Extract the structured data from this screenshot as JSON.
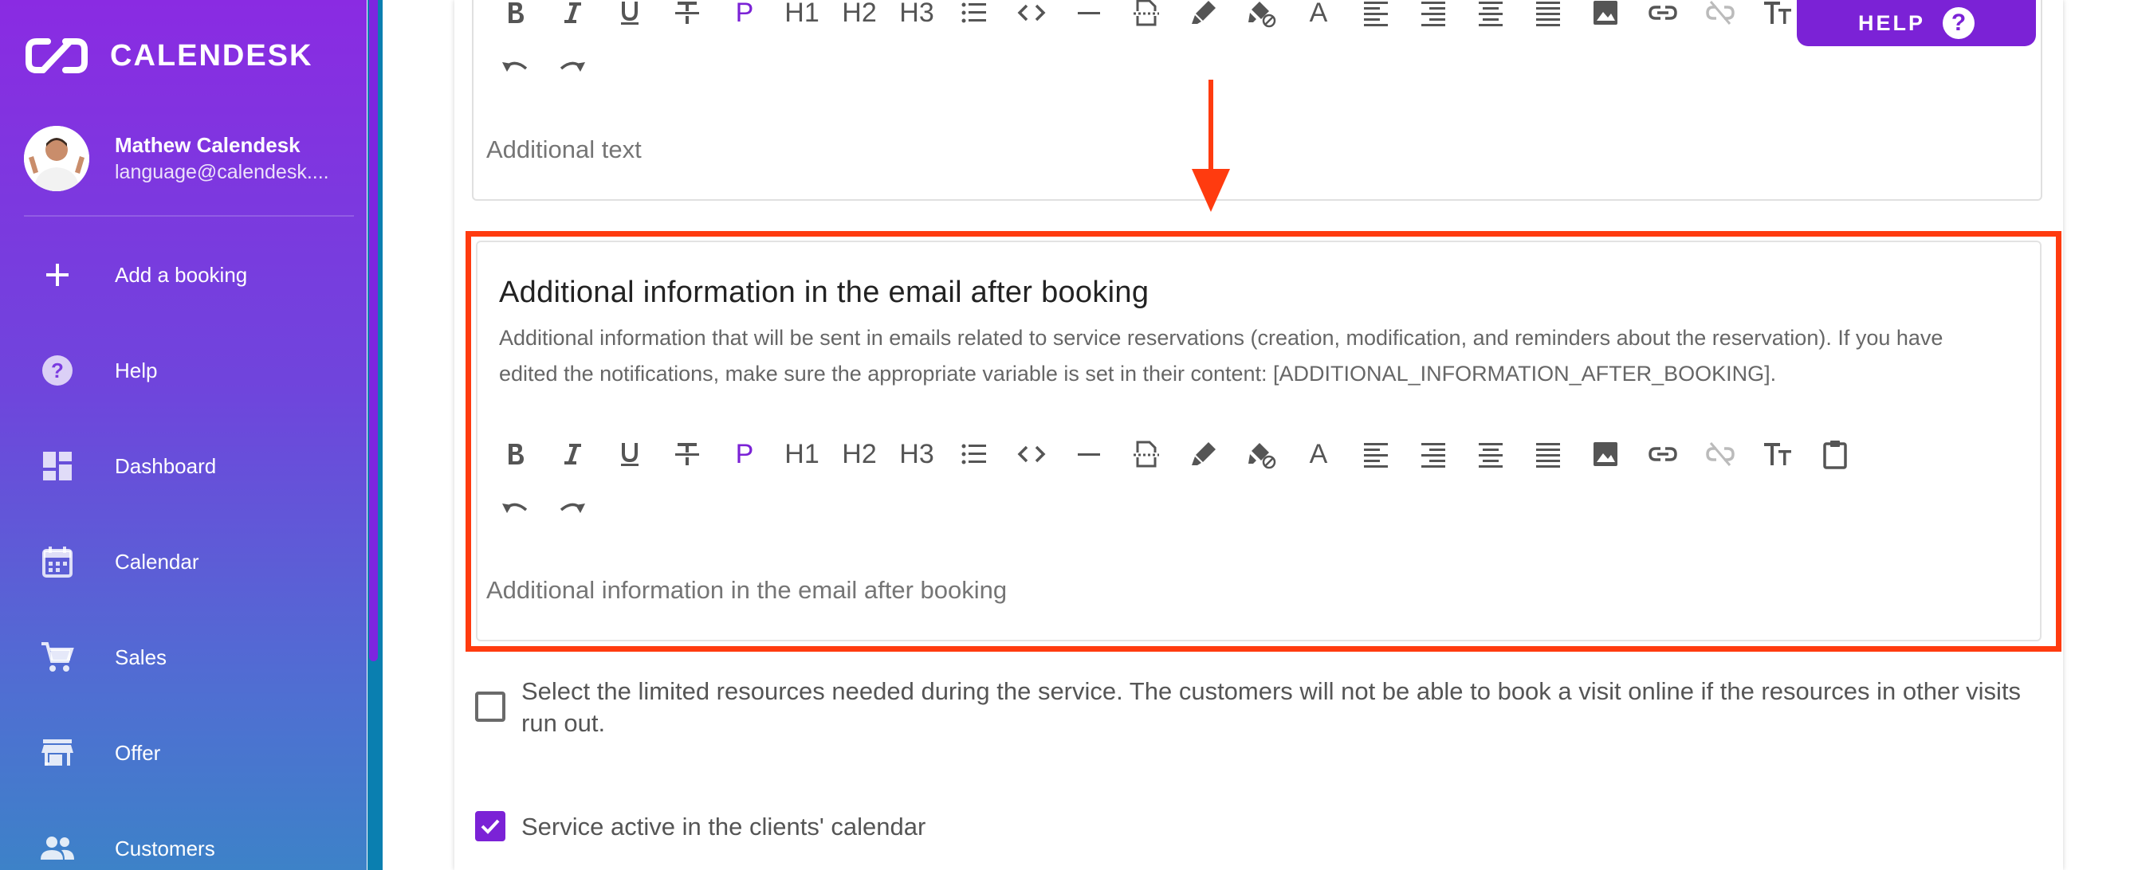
{
  "brand": {
    "name": "CALENDESK"
  },
  "user": {
    "name": "Mathew Calendesk",
    "email": "language@calendesk...."
  },
  "nav": [
    {
      "label": "Add a booking",
      "icon": "plus-icon"
    },
    {
      "label": "Help",
      "icon": "help-circle-icon"
    },
    {
      "label": "Dashboard",
      "icon": "dashboard-icon"
    },
    {
      "label": "Calendar",
      "icon": "calendar-icon"
    },
    {
      "label": "Sales",
      "icon": "cart-icon"
    },
    {
      "label": "Offer",
      "icon": "store-icon"
    },
    {
      "label": "Customers",
      "icon": "people-icon"
    }
  ],
  "help": {
    "label": "HELP",
    "q": "?"
  },
  "toolbar": {
    "p": "P",
    "h1": "H1",
    "h2": "H2",
    "h3": "H3",
    "font": "A"
  },
  "top_editor": {
    "placeholder": "Additional text"
  },
  "section": {
    "title": "Additional information in the email after booking",
    "description": "Additional information that will be sent in emails related to service reservations (creation, modification, and reminders about the reservation). If you have edited the notifications, make sure the appropriate variable is set in their content: [ADDITIONAL_INFORMATION_AFTER_BOOKING].",
    "placeholder": "Additional information in the email after booking"
  },
  "checkboxes": [
    {
      "label": "Select the limited resources needed during the service. The customers will not be able to book a visit online if the resources in other visits run out.",
      "checked": false
    },
    {
      "label": "Service active in the clients' calendar",
      "checked": true
    }
  ],
  "colors": {
    "accent": "#7b22d6",
    "highlight": "#ff3b0f"
  }
}
